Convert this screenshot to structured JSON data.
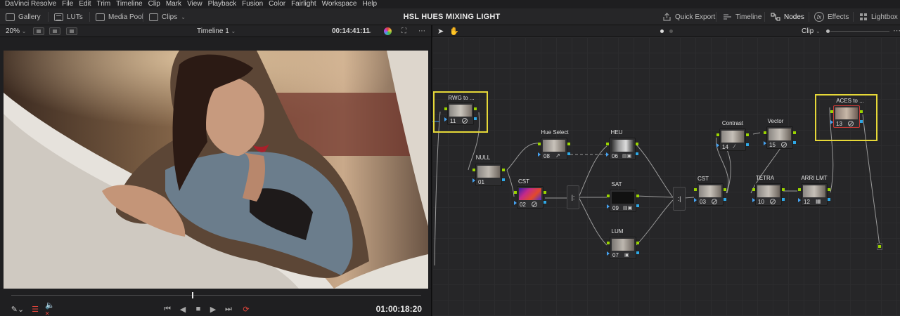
{
  "menu": [
    "DaVinci Resolve",
    "File",
    "Edit",
    "Trim",
    "Timeline",
    "Clip",
    "Mark",
    "View",
    "Playback",
    "Fusion",
    "Color",
    "Fairlight",
    "Workspace",
    "Help"
  ],
  "toolbar": {
    "gallery": "Gallery",
    "luts": "LUTs",
    "media_pool": "Media Pool",
    "clips": "Clips",
    "title": "HSL  HUES MIXING LIGHT",
    "quick_export": "Quick Export",
    "timeline": "Timeline",
    "nodes": "Nodes",
    "effects": "Effects",
    "lightbox": "Lightbox"
  },
  "viewer": {
    "zoom": "20%",
    "timeline_name": "Timeline 1",
    "timecode": "00:14:41:11",
    "transport_timecode": "01:00:18:20",
    "playhead_fraction": 0.44
  },
  "node_editor": {
    "mode": "Clip",
    "nodes": [
      {
        "id": "11",
        "label": "RWG to ..."
      },
      {
        "id": "01",
        "label": "NULL"
      },
      {
        "id": "08",
        "label": "Hue Select"
      },
      {
        "id": "02",
        "label": "CST"
      },
      {
        "id": "06",
        "label": "HEU"
      },
      {
        "id": "09",
        "label": "SAT"
      },
      {
        "id": "07",
        "label": "LUM"
      },
      {
        "id": "03",
        "label": "CST"
      },
      {
        "id": "14",
        "label": "Contrast"
      },
      {
        "id": "15",
        "label": "Vector"
      },
      {
        "id": "10",
        "label": "TETRA"
      },
      {
        "id": "12",
        "label": "ARRI LMT"
      },
      {
        "id": "13",
        "label": "ACES to ..."
      }
    ]
  },
  "colors": {
    "highlight": "#e6d838",
    "pin_green": "#9ad400",
    "pin_blue": "#2ea8e6",
    "error_red": "#e0443a"
  }
}
